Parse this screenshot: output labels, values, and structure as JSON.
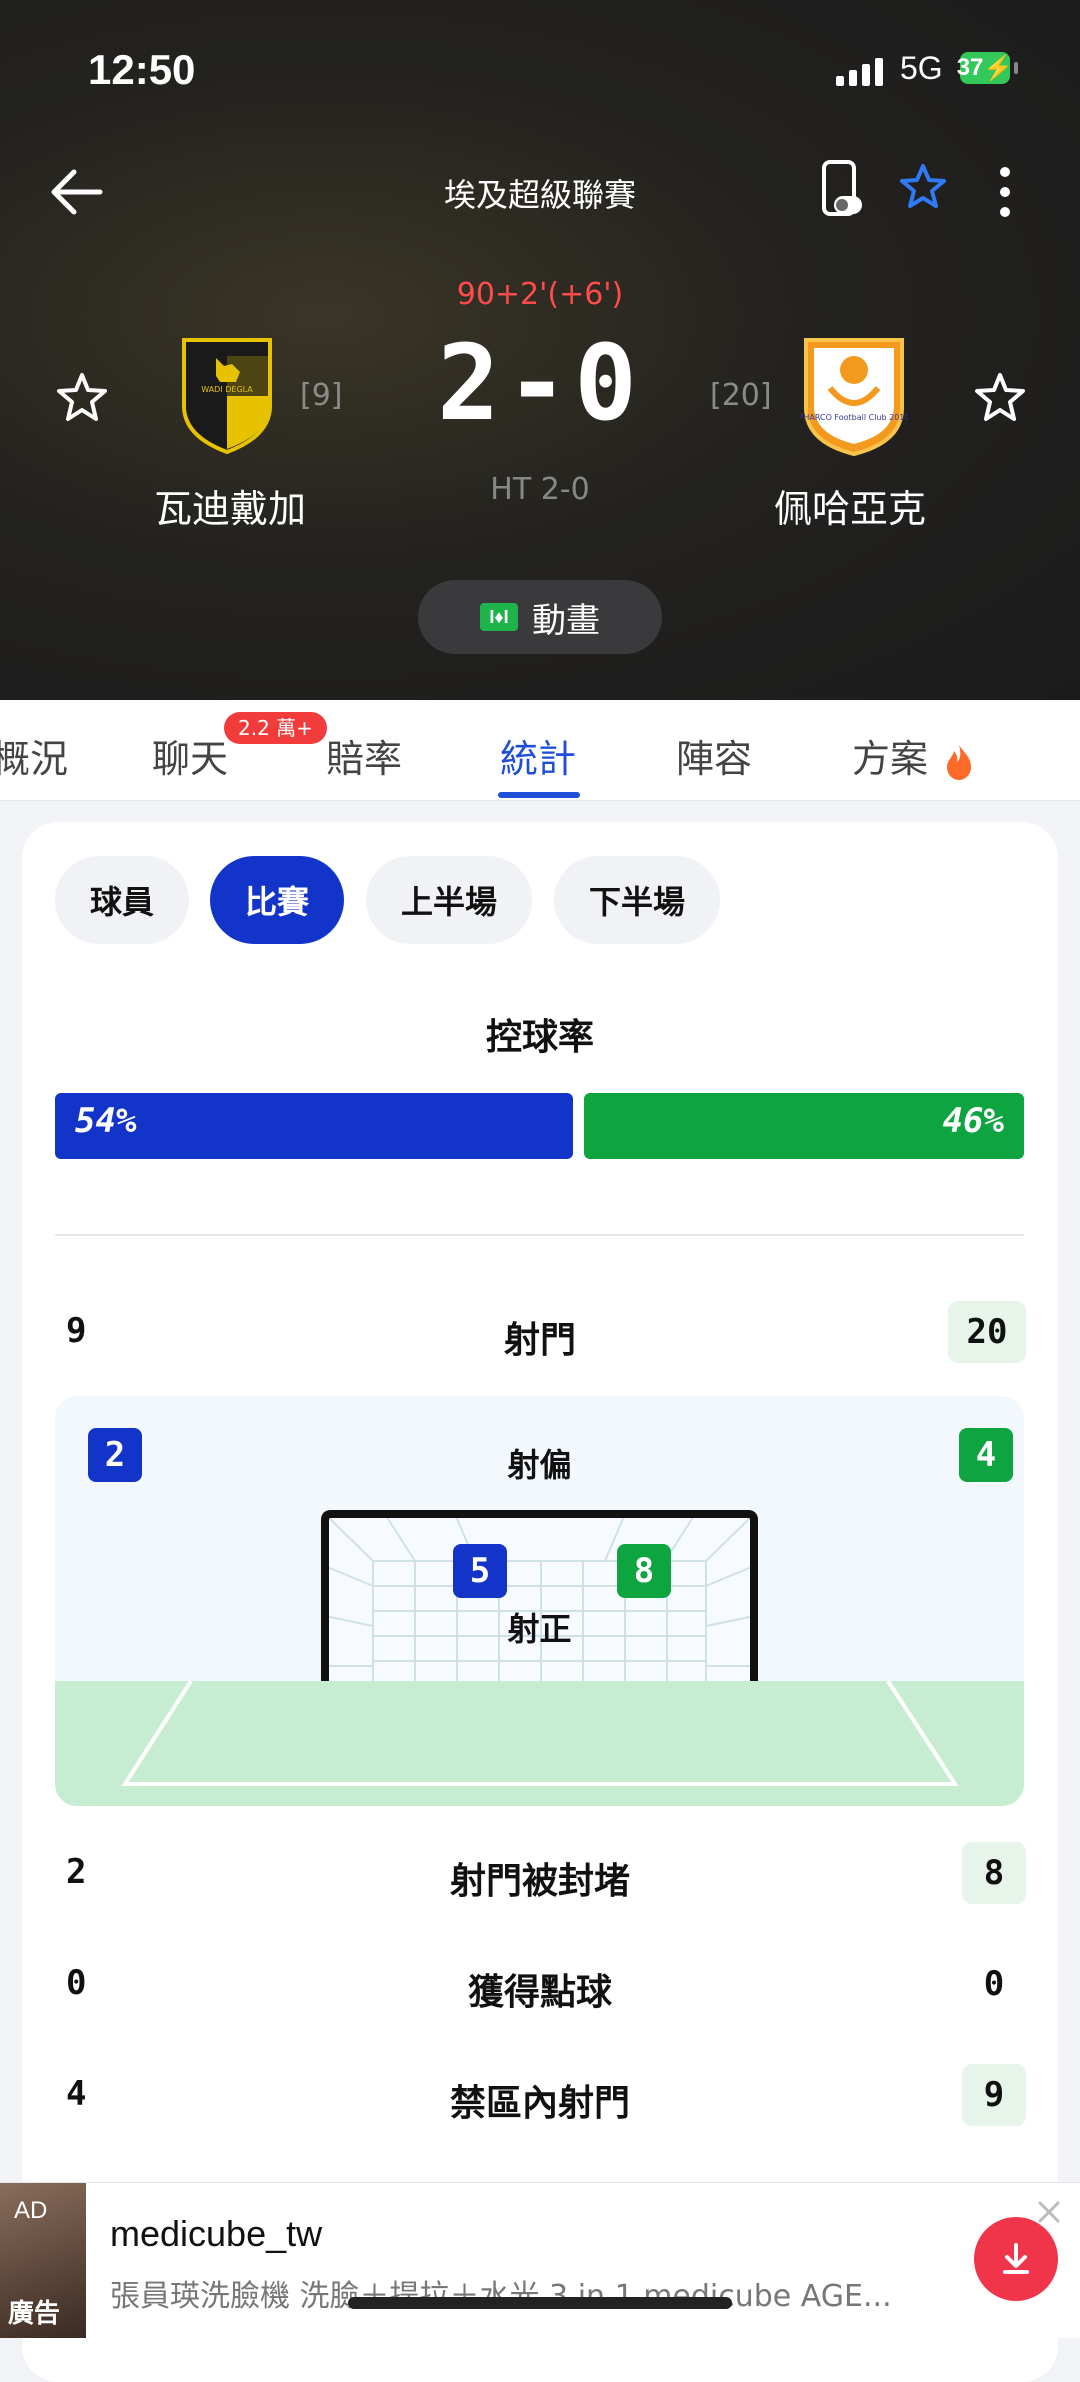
{
  "status_bar": {
    "time": "12:50",
    "network": "5G",
    "battery": "37"
  },
  "match": {
    "league": "埃及超級聯賽",
    "minute": "90+2'(+6')",
    "score": "2-0",
    "halftime": "HT 2-0",
    "home": {
      "name": "瓦迪戴加",
      "rank": "[9]",
      "crest_text": "WADI DEGLA"
    },
    "away": {
      "name": "佩哈亞克",
      "rank": "[20]",
      "crest_text": "PHARCO Football Club 2010"
    },
    "animation_label": "動畫",
    "animation_icon_text": "I♦I"
  },
  "tabs": {
    "items": [
      "概況",
      "聊天",
      "賠率",
      "統計",
      "陣容",
      "方案"
    ],
    "active": "統計",
    "chat_badge": "2.2 萬+"
  },
  "filters": {
    "items": [
      "球員",
      "比賽",
      "上半場",
      "下半場"
    ],
    "active": "比賽"
  },
  "possession": {
    "title": "控球率",
    "home": "54%",
    "away": "46%",
    "home_value": 54,
    "away_value": 46
  },
  "shots": {
    "label": "射門",
    "home": "9",
    "away": "20",
    "off_target_label": "射偏",
    "off_target_home": "2",
    "off_target_away": "4",
    "on_target_label": "射正",
    "on_target_home": "5",
    "on_target_away": "8"
  },
  "stats": [
    {
      "name": "射門被封堵",
      "home": "2",
      "away": "8",
      "highlight": "away"
    },
    {
      "name": "獲得點球",
      "home": "0",
      "away": "0",
      "highlight": "none"
    },
    {
      "name": "禁區內射門",
      "home": "4",
      "away": "9",
      "highlight": "away"
    }
  ],
  "ad": {
    "tag_top": "AD",
    "tag_bottom": "廣告",
    "title": "medicube_tw",
    "description": "張員瑛洗臉機 洗臉＋提拉＋水光 3 in 1 medicube AGE..."
  },
  "colors": {
    "home": "#1334c9",
    "away": "#0ea541",
    "accent": "#1f4ed8",
    "minute": "#ff4b4b"
  }
}
